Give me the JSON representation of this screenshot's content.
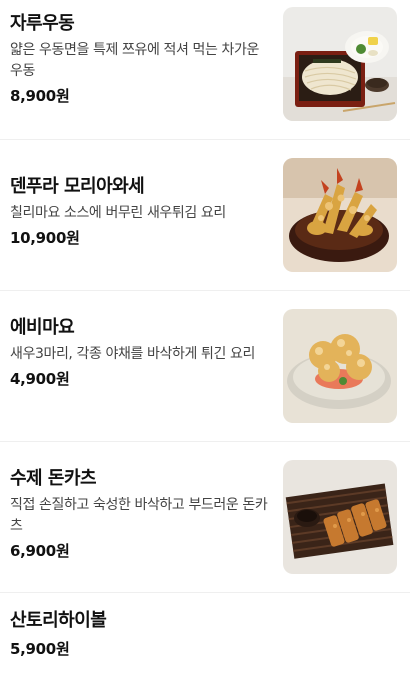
{
  "menu": {
    "items": [
      {
        "name": "자루우동",
        "description": "얇은 우동면을 특제 쯔유에 적셔 먹는 차가운 우동",
        "price": "8,900원",
        "image": "zaru-udon-photo"
      },
      {
        "name": "덴푸라 모리아와세",
        "description": "칠리마요 소스에 버무린 새우튀김 요리",
        "price": "10,900원",
        "image": "tempura-bowl-photo"
      },
      {
        "name": "에비마요",
        "description": "새우3마리, 각종 야채를 바삭하게 튀긴 요리",
        "price": "4,900원",
        "image": "ebi-mayo-photo"
      },
      {
        "name": "수제 돈카츠",
        "description": "직접 손질하고 숙성한 바삭하고 부드러운 돈카츠",
        "price": "6,900원",
        "image": "tonkatsu-photo"
      },
      {
        "name": "산토리하이볼",
        "description": "",
        "price": "5,900원",
        "image": ""
      }
    ]
  }
}
